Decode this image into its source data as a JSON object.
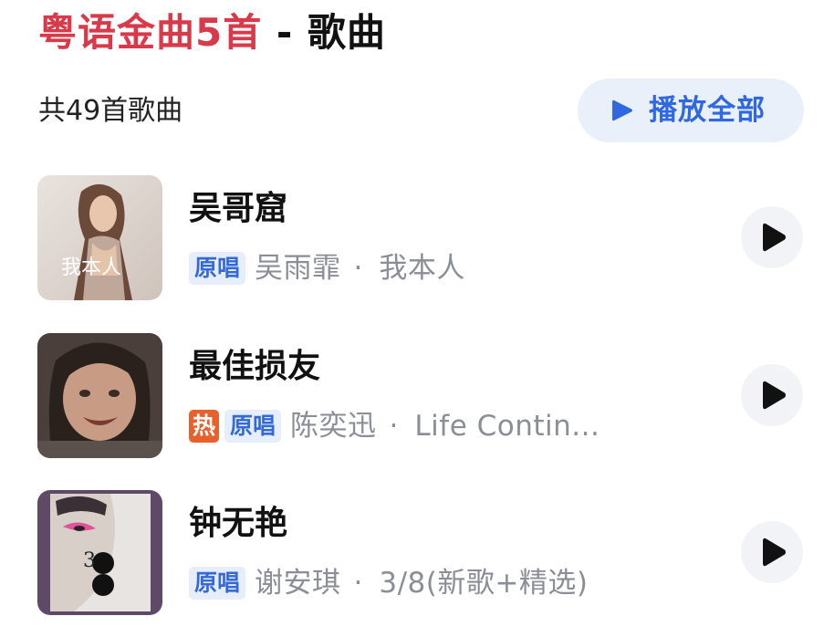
{
  "header": {
    "title_part1": "粤语金曲5首",
    "separator": " - ",
    "title_part2": "歌曲",
    "accent_color": "#d83a4a"
  },
  "summary": {
    "count_label": "共49首歌曲"
  },
  "actions": {
    "play_all_label": "播放全部",
    "play_all_icon": "play-triangle-icon",
    "accent_color": "#2f68e0"
  },
  "songs": [
    {
      "title": "吴哥窟",
      "hot": false,
      "badge": "原唱",
      "artist": "吴雨霏",
      "album": "我本人",
      "cover_text": "我本人"
    },
    {
      "title": "最佳损友",
      "hot": true,
      "hot_badge": "热",
      "badge": "原唱",
      "artist": "陈奕迅",
      "album": "Life Contin..."
    },
    {
      "title": "钟无艳",
      "hot": false,
      "badge": "原唱",
      "artist": "谢安琪",
      "album": "3/8(新歌+精选)",
      "cover_text": "3"
    }
  ],
  "row_separator": "·"
}
